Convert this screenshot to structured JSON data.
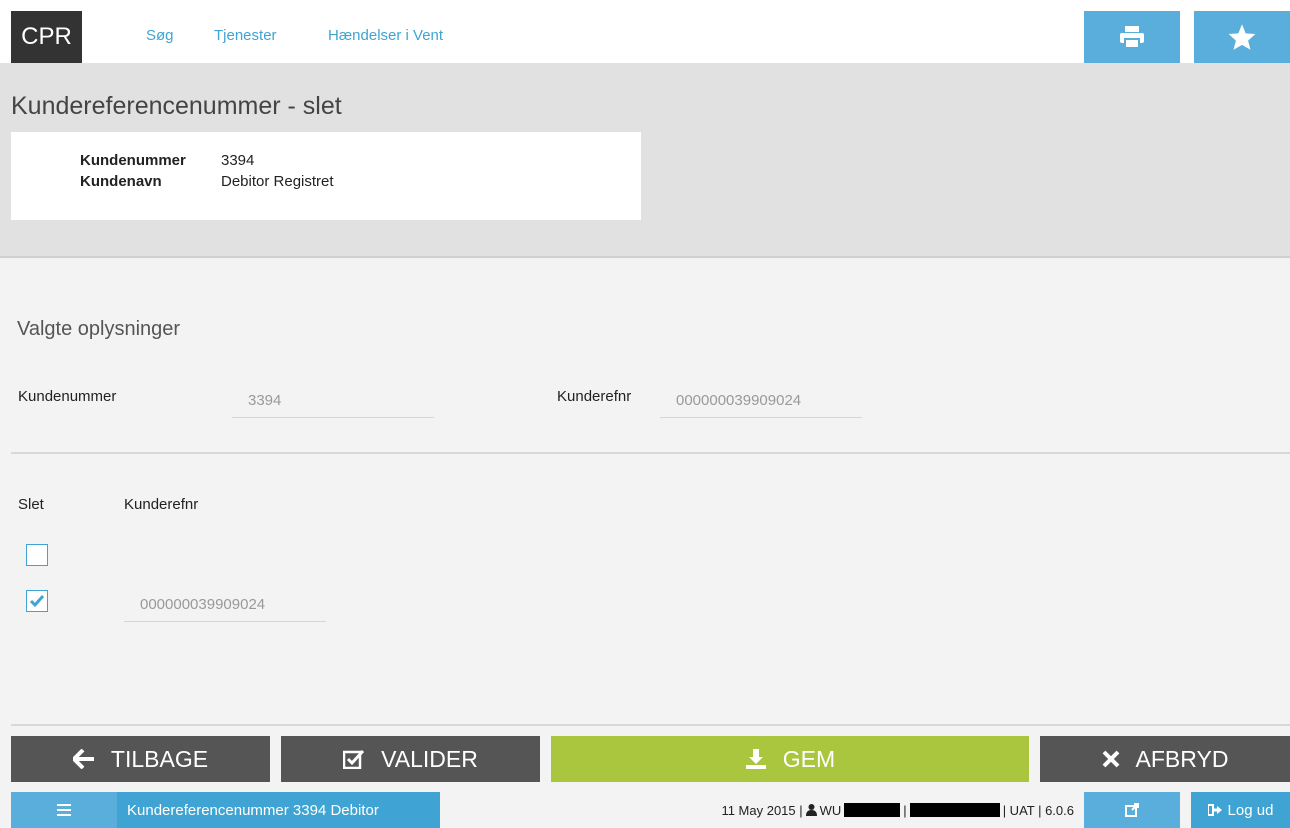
{
  "app": {
    "logo": "CPR"
  },
  "nav": {
    "links": [
      "Søg",
      "Tjenester",
      "Hændelser i Vent"
    ],
    "print_icon": "print-icon",
    "favorite_icon": "star-icon"
  },
  "header": {
    "title": "Kundereferencenummer - slet",
    "info": [
      {
        "label": "Kundenummer",
        "value": "3394"
      },
      {
        "label": "Kundenavn",
        "value": "Debitor Registret"
      }
    ]
  },
  "selected": {
    "title": "Valgte oplysninger",
    "kundenummer_label": "Kundenummer",
    "kundenummer_value": "3394",
    "kunderefnr_label": "Kunderefnr",
    "kunderefnr_value": "000000039909024"
  },
  "list": {
    "col_slet": "Slet",
    "col_kunderefnr": "Kunderefnr",
    "rows": [
      {
        "checked": false,
        "value": ""
      },
      {
        "checked": true,
        "value": "000000039909024"
      }
    ]
  },
  "actions": {
    "back": "TILBAGE",
    "validate": "VALIDER",
    "save": "GEM",
    "cancel": "AFBRYD"
  },
  "footer": {
    "menu_icon": "hamburger-icon",
    "title": "Kundereferencenummer 3394 Debitor",
    "date": "11 May 2015 |",
    "user_prefix": "WU",
    "status_tail": "| UAT | 6.0.6",
    "logout": "Log ud"
  },
  "colors": {
    "accent": "#5aaedc",
    "accent_dark": "#3fa4d3",
    "button_gray": "#555555",
    "button_green": "#a9c63e",
    "header_bg": "#e1e1e1"
  }
}
